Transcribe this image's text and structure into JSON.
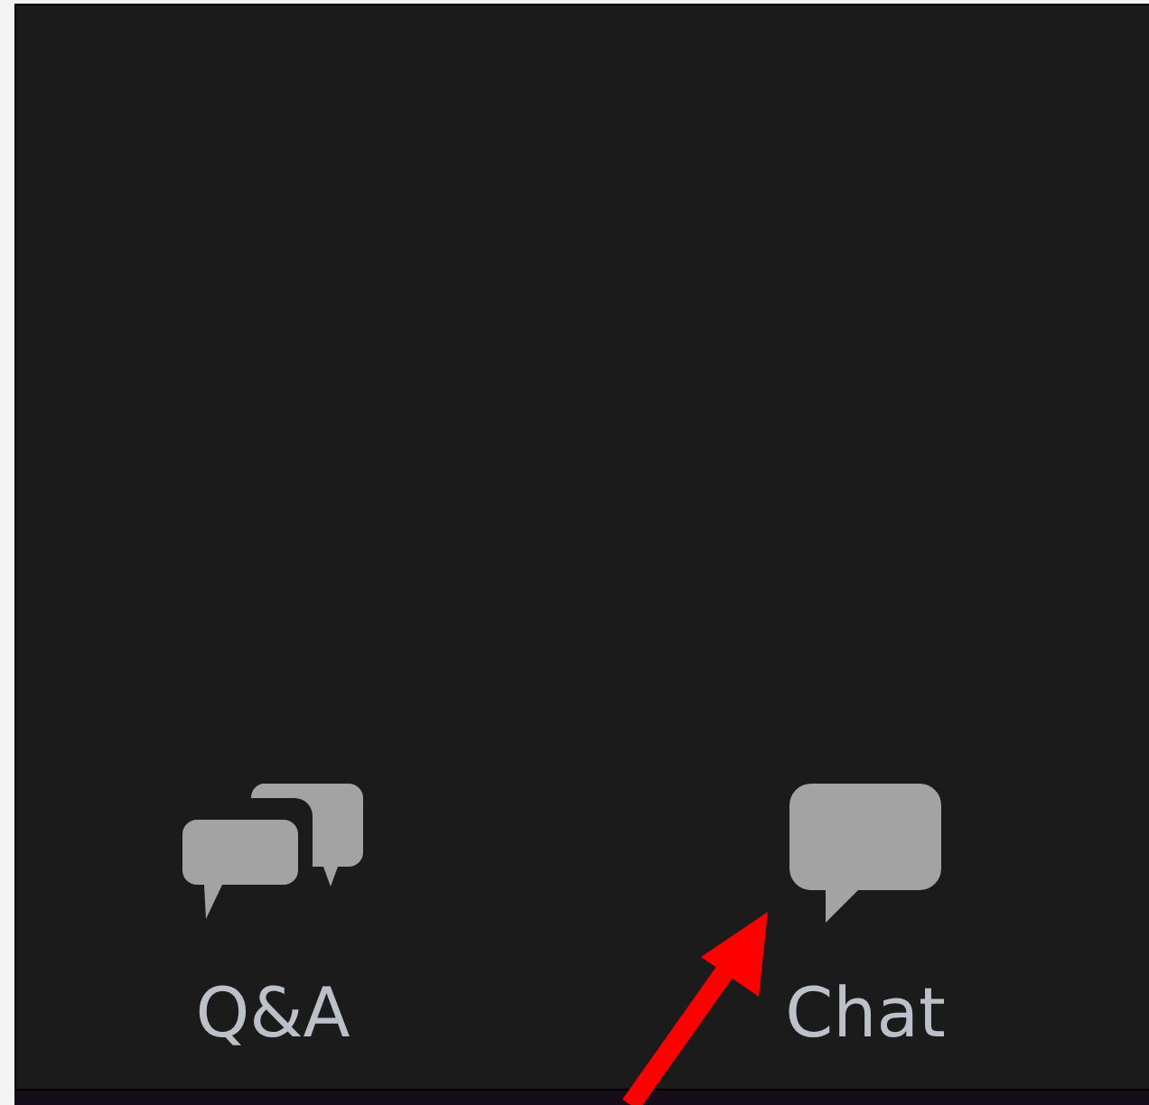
{
  "toolbar": {
    "buttons": [
      {
        "kind": "qa",
        "label": "Q&A"
      },
      {
        "kind": "chat",
        "label": "Chat"
      }
    ]
  }
}
